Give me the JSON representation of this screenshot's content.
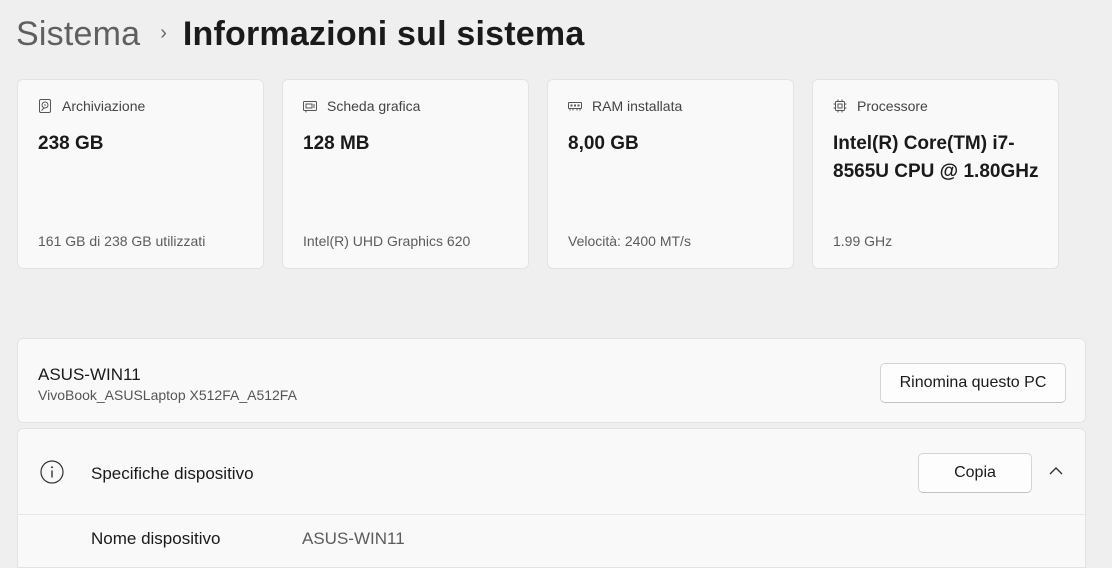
{
  "breadcrumb": {
    "parent": "Sistema",
    "separator": "›",
    "current": "Informazioni sul sistema"
  },
  "cards": [
    {
      "icon": "storage-icon",
      "label": "Archiviazione",
      "value": "238 GB",
      "sub": "161 GB di 238 GB utilizzati"
    },
    {
      "icon": "graphics-card-icon",
      "label": "Scheda grafica",
      "value": "128 MB",
      "sub": "Intel(R) UHD Graphics 620"
    },
    {
      "icon": "ram-icon",
      "label": "RAM installata",
      "value": "8,00 GB",
      "sub": "Velocità: 2400 MT/s"
    },
    {
      "icon": "processor-icon",
      "label": "Processore",
      "value": "Intel(R) Core(TM) i7-8565U CPU @ 1.80GHz",
      "sub": "1.99 GHz"
    }
  ],
  "device": {
    "name": "ASUS-WIN11",
    "model": "VivoBook_ASUSLaptop X512FA_A512FA",
    "rename_label": "Rinomina questo PC"
  },
  "specs": {
    "title": "Specifiche dispositivo",
    "copy_label": "Copia",
    "rows": [
      {
        "label": "Nome dispositivo",
        "value": "ASUS-WIN11"
      }
    ]
  },
  "colors": {
    "background": "#efefef",
    "card": "#f9f9f9",
    "border": "#e3e3e3"
  }
}
